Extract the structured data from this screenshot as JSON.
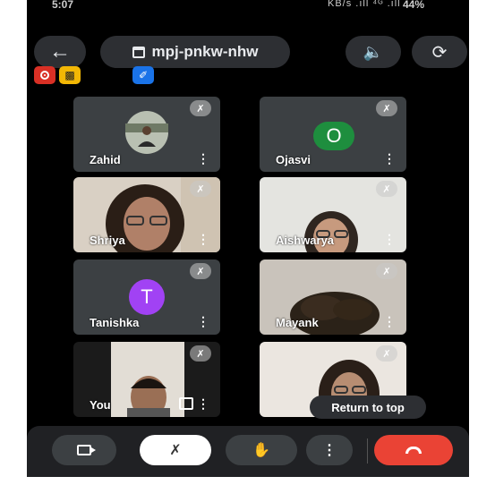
{
  "status_bar": {
    "time": "5:07",
    "network": "KB/s .ıll ⁴ᴳ .ıll",
    "battery": "44%"
  },
  "header": {
    "meeting_code": "mpj-pnkw-nhw"
  },
  "participants": [
    {
      "name": "Zahid",
      "type": "photo-avatar"
    },
    {
      "name": "Ojasvi",
      "type": "letter",
      "letter": "O",
      "color": "#1e8e3e"
    },
    {
      "name": "Shriya",
      "type": "video"
    },
    {
      "name": "Aishwarya",
      "type": "video"
    },
    {
      "name": "Tanishka",
      "type": "letter",
      "letter": "T",
      "color": "#a142f4"
    },
    {
      "name": "Mayank",
      "type": "video"
    },
    {
      "name": "You",
      "type": "video"
    },
    {
      "name": "",
      "type": "video"
    }
  ],
  "return_to_top": "Return to top",
  "icons": {
    "back": "arrow-left-icon",
    "speaker": "speaker-icon",
    "flip": "flip-camera-icon",
    "mute": "mic-off-icon",
    "more": "more-vert-icon",
    "hand": "raise-hand-icon",
    "end": "end-call-icon"
  },
  "colors": {
    "end_call": "#ea4335",
    "tile_bg": "#3c4043",
    "recording": "#d93025"
  }
}
